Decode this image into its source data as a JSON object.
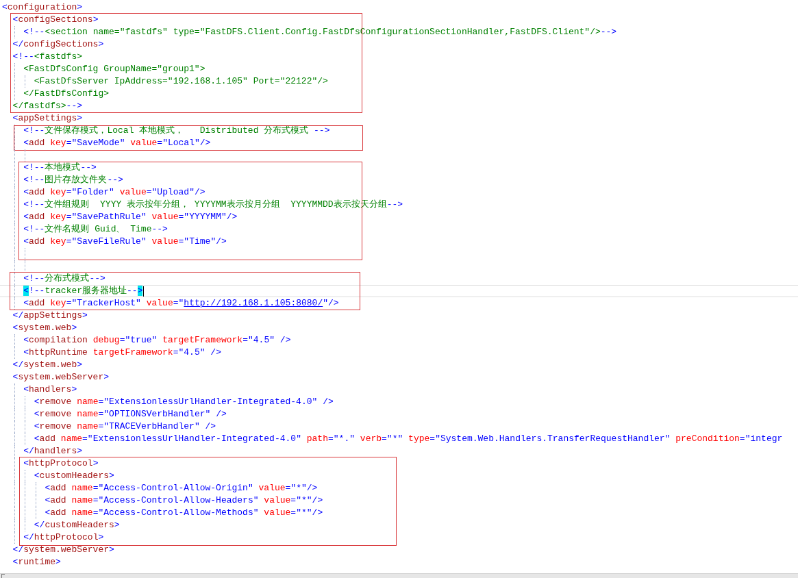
{
  "code": [
    {
      "kind": "line",
      "text": "<configuration>",
      "children": [
        {
          "kind": "group",
          "boxed": true,
          "children": [
            {
              "kind": "line",
              "text": "<configSections>",
              "children": [
                {
                  "kind": "line",
                  "text": "<!--<section name=\"fastdfs\" type=\"FastDFS.Client.Config.FastDfsConfigurationSectionHandler,FastDFS.Client\"/>-->"
                }
              ]
            },
            {
              "kind": "line",
              "text": "</configSections>"
            },
            {
              "kind": "line",
              "text": "<!--<fastdfs>",
              "children": [
                {
                  "kind": "line",
                  "text": "<FastDfsConfig GroupName=\"group1\">",
                  "children": [
                    {
                      "kind": "line",
                      "text": "<FastDfsServer IpAddress=\"192.168.1.105\" Port=\"22122\"/>"
                    }
                  ]
                },
                {
                  "kind": "line",
                  "text": "</FastDfsConfig>"
                }
              ]
            },
            {
              "kind": "line",
              "text": "</fastdfs>-->"
            }
          ]
        },
        {
          "kind": "line",
          "text": "<appSettings>",
          "children": [
            {
              "kind": "group",
              "boxed": true,
              "children": [
                {
                  "kind": "line",
                  "text": "<!--文件保存模式，Local 本地模式，   Distributed 分布式模式 -->"
                },
                {
                  "kind": "line",
                  "text": "<add key=\"SaveMode\" value=\"Local\"/>"
                }
              ]
            },
            {
              "kind": "blank"
            },
            {
              "kind": "group",
              "boxed": true,
              "children": [
                {
                  "kind": "line",
                  "text": "<!--本地模式-->"
                },
                {
                  "kind": "line",
                  "text": "<!--图片存放文件夹-->"
                },
                {
                  "kind": "line",
                  "text": "<add key=\"Folder\" value=\"Upload\"/>"
                },
                {
                  "kind": "line",
                  "text": "<!--文件组规则  YYYY 表示按年分组， YYYYMM表示按月分组  YYYYMMDD表示按天分组-->"
                },
                {
                  "kind": "line",
                  "text": "<add key=\"SavePathRule\" value=\"YYYYMM\"/>"
                },
                {
                  "kind": "line",
                  "text": "<!--文件名规则 Guid、 Time-->"
                },
                {
                  "kind": "line",
                  "text": "<add key=\"SaveFileRule\" value=\"Time\"/>"
                },
                {
                  "kind": "blank"
                }
              ]
            },
            {
              "kind": "blank"
            },
            {
              "kind": "group",
              "boxed": true,
              "children": [
                {
                  "kind": "line",
                  "text": "<!--分布式模式-->"
                },
                {
                  "kind": "line",
                  "text": "<!--tracker服务器地址-->",
                  "current": true,
                  "bracket_match": true
                },
                {
                  "kind": "line",
                  "text": "<add key=\"TrackerHost\" value=\"http://192.168.1.105:8080/\"/>"
                }
              ]
            }
          ]
        },
        {
          "kind": "line",
          "text": "</appSettings>"
        },
        {
          "kind": "line",
          "text": "<system.web>",
          "children": [
            {
              "kind": "line",
              "text": "<compilation debug=\"true\" targetFramework=\"4.5\" />"
            },
            {
              "kind": "line",
              "text": "<httpRuntime targetFramework=\"4.5\" />"
            }
          ]
        },
        {
          "kind": "line",
          "text": "</system.web>"
        },
        {
          "kind": "line",
          "text": "<system.webServer>",
          "children": [
            {
              "kind": "line",
              "text": "<handlers>",
              "children": [
                {
                  "kind": "line",
                  "text": "<remove name=\"ExtensionlessUrlHandler-Integrated-4.0\" />"
                },
                {
                  "kind": "line",
                  "text": "<remove name=\"OPTIONSVerbHandler\" />"
                },
                {
                  "kind": "line",
                  "text": "<remove name=\"TRACEVerbHandler\" />"
                },
                {
                  "kind": "line",
                  "text": "<add name=\"ExtensionlessUrlHandler-Integrated-4.0\" path=\"*.\" verb=\"*\" type=\"System.Web.Handlers.TransferRequestHandler\" preCondition=\"integr"
                }
              ]
            },
            {
              "kind": "line",
              "text": "</handlers>"
            },
            {
              "kind": "group",
              "boxed": true,
              "children": [
                {
                  "kind": "line",
                  "text": "<httpProtocol>",
                  "children": [
                    {
                      "kind": "line",
                      "text": "<customHeaders>",
                      "children": [
                        {
                          "kind": "line",
                          "text": "<add name=\"Access-Control-Allow-Origin\" value=\"*\"/>"
                        },
                        {
                          "kind": "line",
                          "text": "<add name=\"Access-Control-Allow-Headers\" value=\"*\"/>"
                        },
                        {
                          "kind": "line",
                          "text": "<add name=\"Access-Control-Allow-Methods\" value=\"*\"/>"
                        }
                      ]
                    },
                    {
                      "kind": "line",
                      "text": "</customHeaders>"
                    }
                  ]
                },
                {
                  "kind": "line",
                  "text": "</httpProtocol>"
                }
              ]
            }
          ]
        },
        {
          "kind": "line",
          "text": "</system.webServer>"
        },
        {
          "kind": "line",
          "text": "<runtime>"
        }
      ]
    }
  ]
}
